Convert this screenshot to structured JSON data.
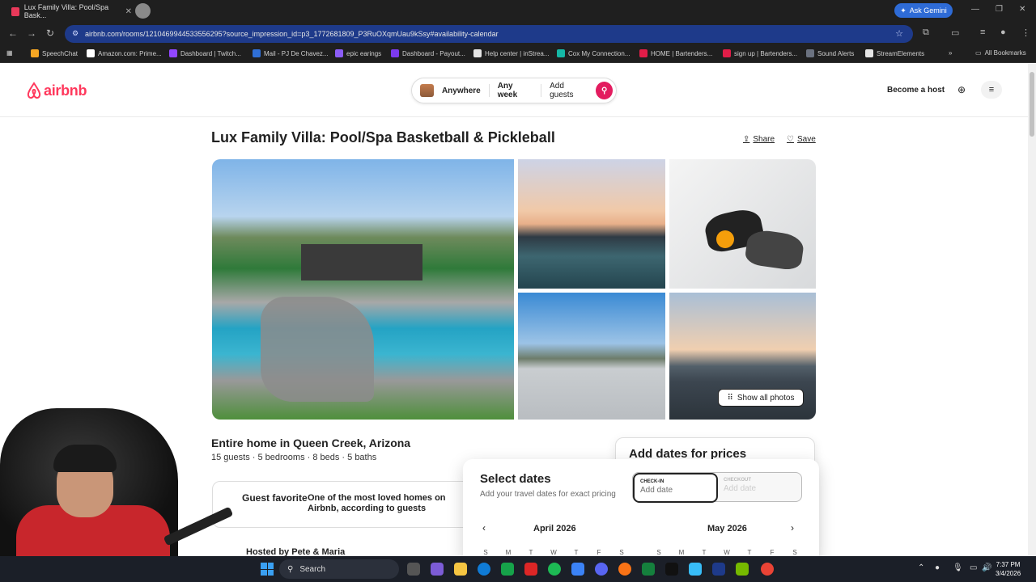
{
  "browser": {
    "tab_title": "Lux Family Villa: Pool/Spa Bask...",
    "ask_gemini": "Ask Gemini",
    "url": "airbnb.com/rooms/1210469944533556295?source_impression_id=p3_1772681809_P3RuOXqmUau9kSsy#availability-calendar",
    "bookmarks": [
      {
        "label": "SpeechChat",
        "color": "#f5a623"
      },
      {
        "label": "Amazon.com: Prime...",
        "color": "#ffffff"
      },
      {
        "label": "Dashboard | Twitch...",
        "color": "#9146ff"
      },
      {
        "label": "Mail - PJ De Chavez...",
        "color": "#2f6fd6"
      },
      {
        "label": "epic earings",
        "color": "#8b5cf6"
      },
      {
        "label": "Dashboard - Payout...",
        "color": "#7c3aed"
      },
      {
        "label": "Help center | inStrea...",
        "color": "#e5e5e5"
      },
      {
        "label": "Cox My Connection...",
        "color": "#15b8a6"
      },
      {
        "label": "HOME | Bartenders...",
        "color": "#e11d48"
      },
      {
        "label": "sign up | Bartenders...",
        "color": "#e11d48"
      },
      {
        "label": "Sound Alerts",
        "color": "#6b7280"
      },
      {
        "label": "StreamElements",
        "color": "#e5e5e5"
      }
    ],
    "all_bookmarks": "All Bookmarks"
  },
  "header": {
    "logo_text": "airbnb",
    "search": {
      "where": "Anywhere",
      "when": "Any week",
      "who": "Add guests"
    },
    "become_host": "Become a host"
  },
  "listing": {
    "title": "Lux Family Villa: Pool/Spa Basketball & Pickleball",
    "share": "Share",
    "save": "Save",
    "show_all_photos": "Show all photos",
    "type_location": "Entire home in Queen Creek, Arizona",
    "specs": "15 guests · 5 bedrooms · 8 beds · 5 baths",
    "guest_favorite": "Guest favorite",
    "guest_favorite_desc": "One of the most loved homes on Airbnb, according to guests",
    "hosted_by": "Hosted by Pete & Maria"
  },
  "booking": {
    "add_dates_heading": "Add dates for prices"
  },
  "calendar": {
    "heading": "Select dates",
    "subheading": "Add your travel dates for exact pricing",
    "checkin_label": "CHECK-IN",
    "checkin_placeholder": "Add date",
    "checkout_label": "CHECKOUT",
    "checkout_placeholder": "Add date",
    "month_left": "April 2026",
    "month_right": "May 2026",
    "weekdays": [
      "S",
      "M",
      "T",
      "W",
      "T",
      "F",
      "S"
    ]
  },
  "taskbar": {
    "search_label": "Search",
    "time": "7:37 PM",
    "date": "3/4/2026"
  },
  "colors": {
    "brand": "#ff385c",
    "search_button": "#e31c5f",
    "url_bar": "#1e3a8a"
  }
}
